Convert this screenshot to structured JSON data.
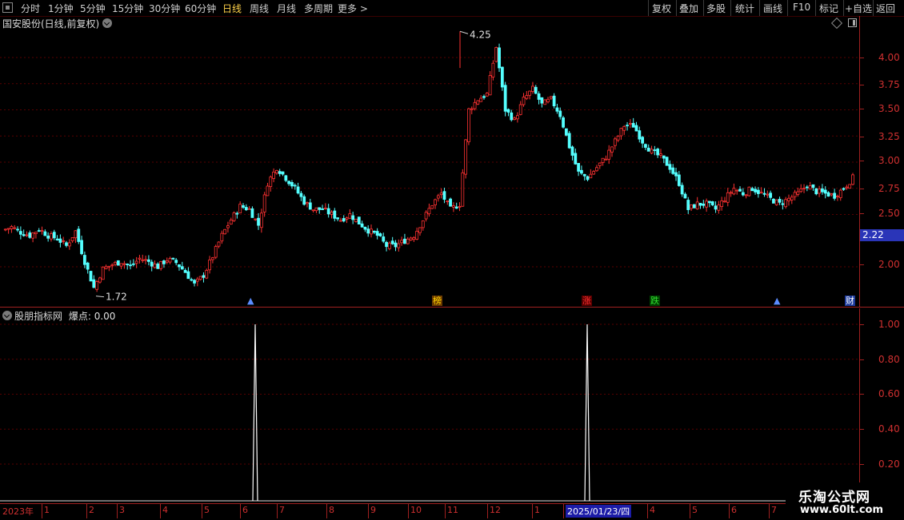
{
  "toolbar": {
    "periods": [
      "分时",
      "1分钟",
      "5分钟",
      "15分钟",
      "30分钟",
      "60分钟",
      "日线",
      "周线",
      "月线",
      "多周期",
      "更多"
    ],
    "active_period": "日线",
    "more_arrow": ">",
    "actions": [
      "复权",
      "叠加",
      "多股",
      "统计",
      "画线",
      "F10",
      "标记",
      "+自选",
      "返回"
    ]
  },
  "main_panel": {
    "title": "国安股份(日线,前复权)",
    "current_price": "2.22",
    "high_label": "4.25",
    "low_label": "1.72",
    "y_ticks": [
      "4.00",
      "3.75",
      "3.50",
      "3.25",
      "3.00",
      "2.75",
      "2.50",
      "2.00"
    ],
    "event_markers": [
      {
        "label": "▲",
        "color": "#5a8cff",
        "bg": "transparent"
      },
      {
        "label": "榜",
        "color": "#ffd400",
        "bg": "#6b3a00"
      },
      {
        "label": "涨",
        "color": "#ff3030",
        "bg": "#5a0000"
      },
      {
        "label": "跌",
        "color": "#30e030",
        "bg": "#004000"
      },
      {
        "label": "▲",
        "color": "#5a8cff",
        "bg": "transparent"
      },
      {
        "label": "财",
        "color": "#ffffff",
        "bg": "#1c3a9c"
      }
    ]
  },
  "indicator_panel": {
    "title": "股朋指标网",
    "value_label": "爆点: 0.00",
    "y_ticks": [
      "1.00",
      "0.80",
      "0.60",
      "0.40",
      "0.20"
    ]
  },
  "x_axis": {
    "labels": [
      "2023年",
      "1",
      "2",
      "3",
      "4",
      "5",
      "6",
      "7",
      "8",
      "9",
      "10",
      "11",
      "12",
      "1",
      "2025/01/23/四",
      "4",
      "5",
      "6",
      "7"
    ]
  },
  "watermark": {
    "line1": "乐淘公式网",
    "line2": "www.60lt.com"
  },
  "chart_data": {
    "type": "candlestick",
    "title": "国安股份(日线,前复权)",
    "ylim": [
      1.72,
      4.25
    ],
    "y_ticks": [
      2.0,
      2.5,
      2.75,
      3.0,
      3.25,
      3.5,
      3.75,
      4.0
    ],
    "annotations": {
      "high": 4.25,
      "low": 1.72,
      "last": 2.22
    },
    "closes_approx": [
      2.35,
      2.38,
      2.33,
      2.3,
      2.36,
      2.3,
      2.27,
      2.2,
      2.34,
      2.05,
      1.8,
      1.98,
      2.02,
      2.05,
      2.0,
      2.08,
      2.05,
      2.0,
      2.07,
      2.04,
      1.95,
      1.83,
      1.92,
      2.1,
      2.3,
      2.45,
      2.58,
      2.55,
      2.4,
      2.8,
      2.95,
      2.85,
      2.75,
      2.62,
      2.55,
      2.55,
      2.5,
      2.45,
      2.5,
      2.42,
      2.35,
      2.3,
      2.2,
      2.2,
      2.25,
      2.3,
      2.45,
      2.6,
      2.7,
      2.55,
      2.6,
      3.5,
      3.6,
      3.65,
      4.1,
      3.5,
      3.4,
      3.6,
      3.7,
      3.55,
      3.6,
      3.45,
      3.15,
      2.9,
      2.85,
      2.95,
      3.05,
      3.2,
      3.35,
      3.35,
      3.2,
      3.1,
      3.05,
      2.95,
      2.8,
      2.55,
      2.6,
      2.6,
      2.55,
      2.65,
      2.75,
      2.7,
      2.75,
      2.7,
      2.65,
      2.6,
      2.65,
      2.7,
      2.78,
      2.72,
      2.7,
      2.68,
      2.75,
      2.85
    ],
    "indicator": {
      "name": "爆点",
      "ylim": [
        0,
        1.0
      ],
      "spikes": [
        {
          "x_label": "6",
          "value": 1.0
        },
        {
          "x_label": "2025/01/23/四",
          "value": 1.0
        }
      ],
      "current": 0.0
    }
  }
}
